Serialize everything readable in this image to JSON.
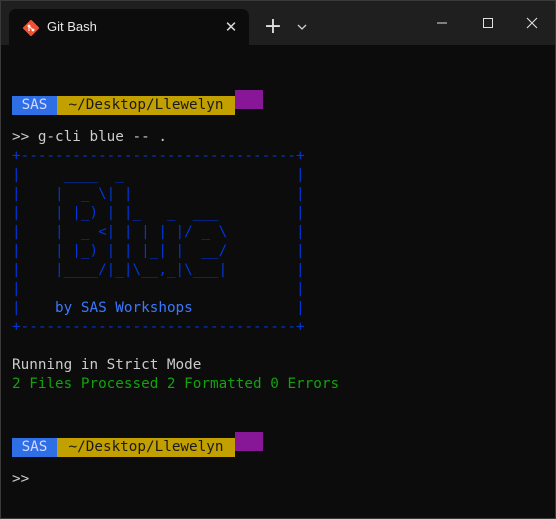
{
  "window": {
    "tab_title": "Git Bash",
    "tab_icon": "git-icon",
    "close_tab_glyph": "✕",
    "new_tab_glyph": "+",
    "controls": [
      "minimize-icon",
      "maximize-icon",
      "close-icon"
    ]
  },
  "colors": {
    "prompt_user_bg": "#2f6fe6",
    "prompt_path_bg": "#c2a000",
    "prompt_end_bg": "#881798",
    "ascii_box": "#0037da",
    "success_text": "#13a10e"
  },
  "terminal": {
    "prompt1": {
      "user": "SAS",
      "path": "~/Desktop/Llewelyn"
    },
    "command_line": ">> g-cli blue -- .",
    "banner_lines": [
      "+--------------------------------+",
      "|     ____  _                    |",
      "|    |  _ \\| |                   |",
      "|    | |_) | |_   _  ___         |",
      "|    |  _ <| | | | |/ _ \\        |",
      "|    | |_) | | |_| |  __/        |",
      "|    |____/|_|\\__,_|\\___|        |",
      "|                                |",
      "|    by SAS Workshops            |",
      "+--------------------------------+"
    ],
    "status_line": "Running in Strict Mode",
    "result_line": "2 Files Processed 2 Formatted 0 Errors",
    "prompt2": {
      "user": "SAS",
      "path": "~/Desktop/Llewelyn"
    },
    "final_prompt": ">>"
  }
}
